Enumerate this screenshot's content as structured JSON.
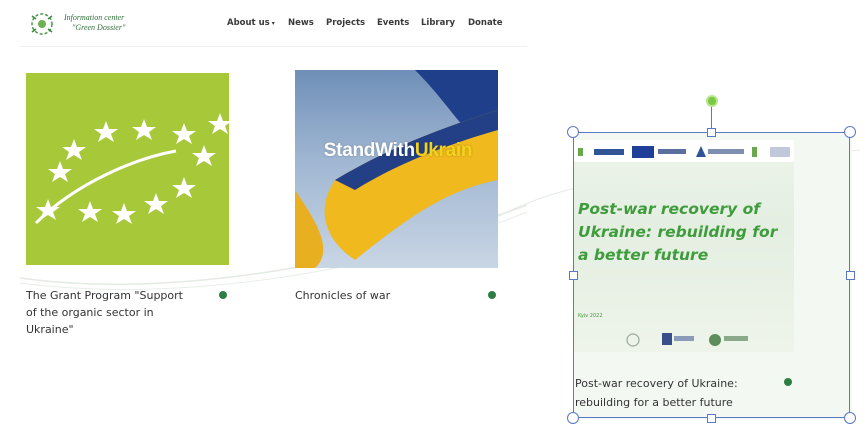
{
  "header": {
    "logo_line1": "Information center",
    "logo_line2": "\"Green Dossier\"",
    "nav": [
      "About us",
      "News",
      "Projects",
      "Events",
      "Library",
      "Donate"
    ],
    "about_suffix": " ▾"
  },
  "cards": [
    {
      "caption": "The Grant Program \"Support of the organic sector in Ukraine\""
    },
    {
      "caption": "Chronicles of war",
      "image_text_a": "StandWith",
      "image_text_b": "Ukrain"
    },
    {
      "caption": "Post-war recovery of Ukraine: rebuilding for a better future",
      "poster_title": "Post-war recovery of Ukraine: rebuilding for a better future",
      "poster_date": "Kyiv 2022"
    }
  ],
  "colors": {
    "brand_green": "#2e7d45",
    "organic_green": "#a6c839",
    "selection_blue": "#5b78c8",
    "ukraine_yellow": "#f3d21b",
    "ukraine_blue": "#1f3f8a"
  }
}
